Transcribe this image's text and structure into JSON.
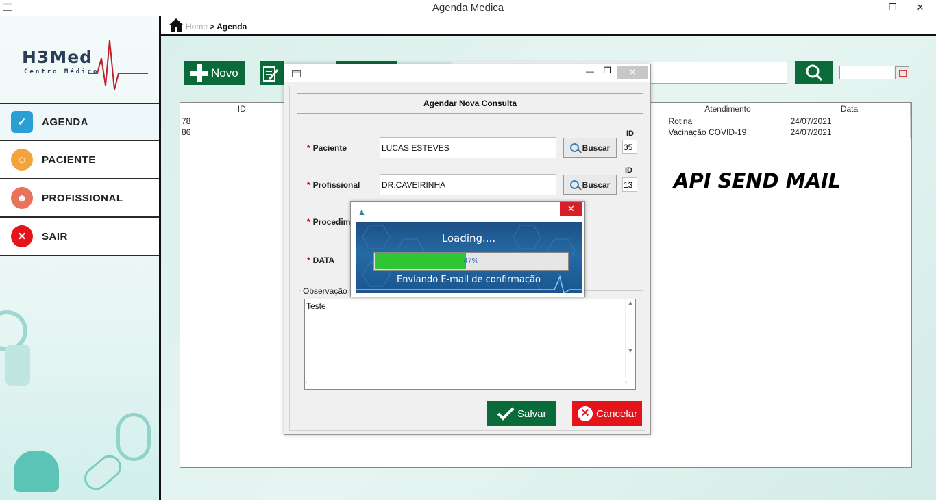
{
  "window": {
    "title": "Agenda Medica",
    "min": "—",
    "max": "❐",
    "close": "✕"
  },
  "logo": {
    "brand": "H3Med",
    "subtitle": "Centro Médico"
  },
  "sidebar": {
    "items": [
      {
        "label": "AGENDA",
        "icon": "calendar-clipboard-icon",
        "color": "#2a9fd6"
      },
      {
        "label": "PACIENTE",
        "icon": "patient-icon",
        "color": "#f2a33a"
      },
      {
        "label": "PROFISSIONAL",
        "icon": "doctor-icon",
        "color": "#e8725c"
      },
      {
        "label": "SAIR",
        "icon": "exit-x-icon",
        "color": "#e5141b"
      }
    ]
  },
  "breadcrumb": {
    "home": "Home",
    "sep": " > ",
    "current": "Agenda"
  },
  "toolbar": {
    "novo_label": "Novo",
    "search_value": "",
    "date_value": ""
  },
  "table": {
    "columns": [
      "ID",
      "",
      "",
      "",
      "Atendimento",
      "Data"
    ],
    "rows": [
      {
        "id": "78",
        "atendimento": "Rotina",
        "data": "24/07/2021"
      },
      {
        "id": "86",
        "atendimento": "Vacinação COVID-19",
        "data": "24/07/2021"
      }
    ]
  },
  "api_label": "API SEND MAIL",
  "dialog": {
    "header": "Agendar Nova Consulta",
    "required_mark": "*",
    "paciente_label": "Paciente",
    "paciente_value": "LUCAS ESTEVES",
    "paciente_id_label": "ID",
    "paciente_id": "35",
    "profissional_label": "Profissional",
    "profissional_value": "DR.CAVEIRINHA",
    "profissional_id_label": "ID",
    "profissional_id": "13",
    "procedimento_label": "Procedim",
    "data_label": "DATA",
    "buscar_label": "Buscar",
    "obs_label": "Observação",
    "obs_value": "Teste",
    "salvar_label": "Salvar",
    "cancelar_label": "Cancelar"
  },
  "loading": {
    "title": "Loading....",
    "percent_text": "47%",
    "progress": 0.47,
    "message": "Enviando E-mail de confirmação",
    "close": "✕"
  },
  "colors": {
    "accent_green": "#0a6b3a",
    "danger_red": "#e5141b",
    "brand_navy": "#2b3e58",
    "brand_red": "#c0212b"
  }
}
